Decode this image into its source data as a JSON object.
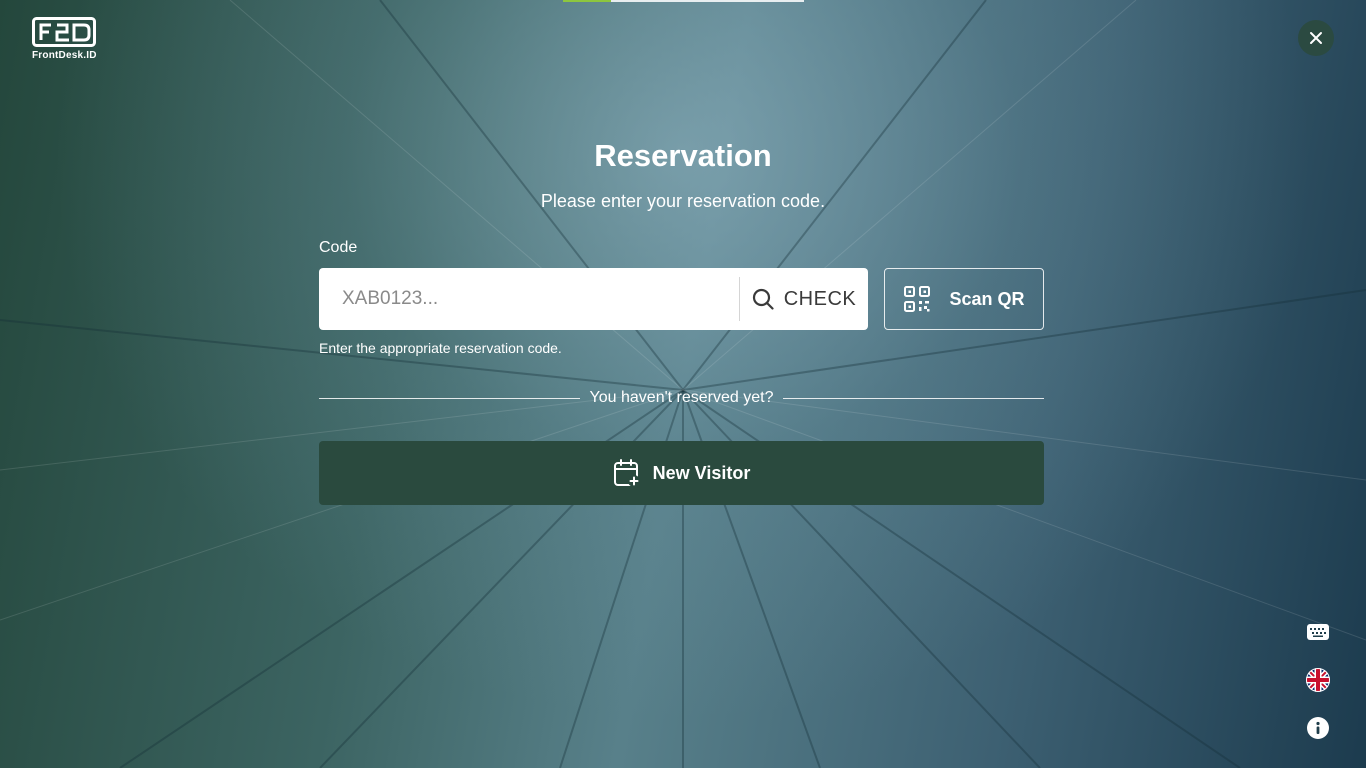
{
  "brand": {
    "name": "FrontDesk.ID"
  },
  "header": {
    "close_icon": "close-icon",
    "progress_fraction": 0.2
  },
  "form": {
    "title": "Reservation",
    "subtitle": "Please enter your reservation code.",
    "code_label": "Code",
    "code_placeholder": "XAB0123...",
    "code_value": "",
    "check_label": "CHECK",
    "scan_label": "Scan QR",
    "hint": "Enter the appropriate reservation code.",
    "divider_text": "You haven't reserved yet?",
    "new_visitor_label": "New Visitor"
  },
  "side_controls": {
    "icons": [
      "keyboard-icon",
      "uk-flag-icon",
      "info-icon"
    ]
  },
  "colors": {
    "accent_dark_green": "#2a4a3e",
    "progress_green": "#8dc63f"
  }
}
